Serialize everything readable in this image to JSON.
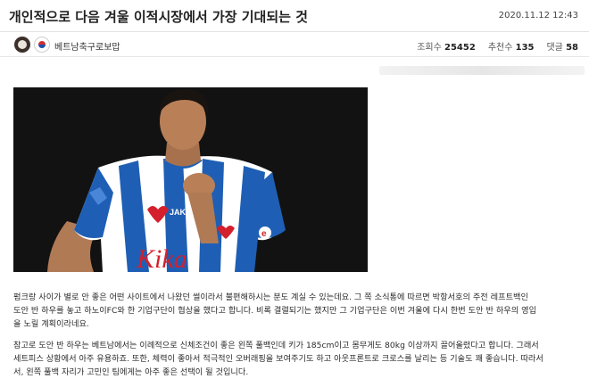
{
  "post": {
    "title": "개인적으로 다음 겨울 이적시장에서 가장 기대되는 것",
    "datetime": "2020.11.12 12:43"
  },
  "author": {
    "name": "베트남축구로보맙"
  },
  "stats": {
    "views_label": "조회수",
    "views": "25452",
    "recommend_label": "추천수",
    "recommend": "135",
    "comments_label": "댓글",
    "comments": "58"
  },
  "photo": {
    "jersey_brand": "JAKO",
    "chest_text": "Kika",
    "sleeve_text": "e"
  },
  "body": {
    "p1_l1": "펌크랑 사이가 별로 안 좋은 어떤 사이트에서 나왔던 썰이라서 불편해하시는 분도 계실 수 있는데요. 그 쪽 소식통에 따르면 박항서호의 주전 레프트백인",
    "p1_l2": "도안 반 하우를 놓고 하노이FC와 한 기업구단이 협상을 했다고 합니다. 비록 결렬되기는 했지만 그 기업구단은 이번 겨울에 다시 한번 도안 반 하우의 영입",
    "p1_l3": "을 노릴 계획이라네요.",
    "p2_l1": "참고로 도안 반 하우는 베트남에서는 이례적으로 신체조건이 좋은 왼쪽 풀백인데 키가 185cm이고 몸무게도 80kg 이상까지 끌어올렸다고 합니다. 그래서",
    "p2_l2": "세트피스 상황에서 아주 유용하죠. 또한, 체력이 좋아서 적극적인 오버래핑을 보여주기도 하고 아웃프론트로 크로스를 날리는 등 기술도 꽤 좋습니다. 따라서",
    "p2_l3": "서, 왼쪽 풀백 자리가 고민인 팀에게는 아주 좋은 선택이 될 것입니다."
  }
}
